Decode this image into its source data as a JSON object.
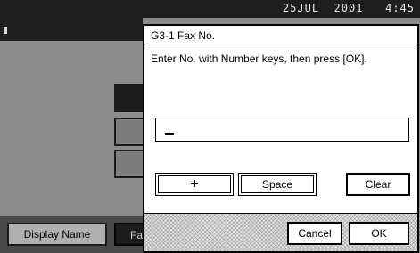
{
  "status_bar": {
    "datetime": "25JUL  2001   4:45"
  },
  "background": {
    "display_name_label": "Display Name",
    "fax_tab_label": "Fax"
  },
  "dialog": {
    "title": "G3-1 Fax No.",
    "instruction": "Enter No. with Number keys, then press [OK].",
    "field_value": "",
    "buttons": {
      "plus": "+",
      "space": "Space",
      "clear": "Clear",
      "cancel": "Cancel",
      "ok": "OK"
    }
  }
}
